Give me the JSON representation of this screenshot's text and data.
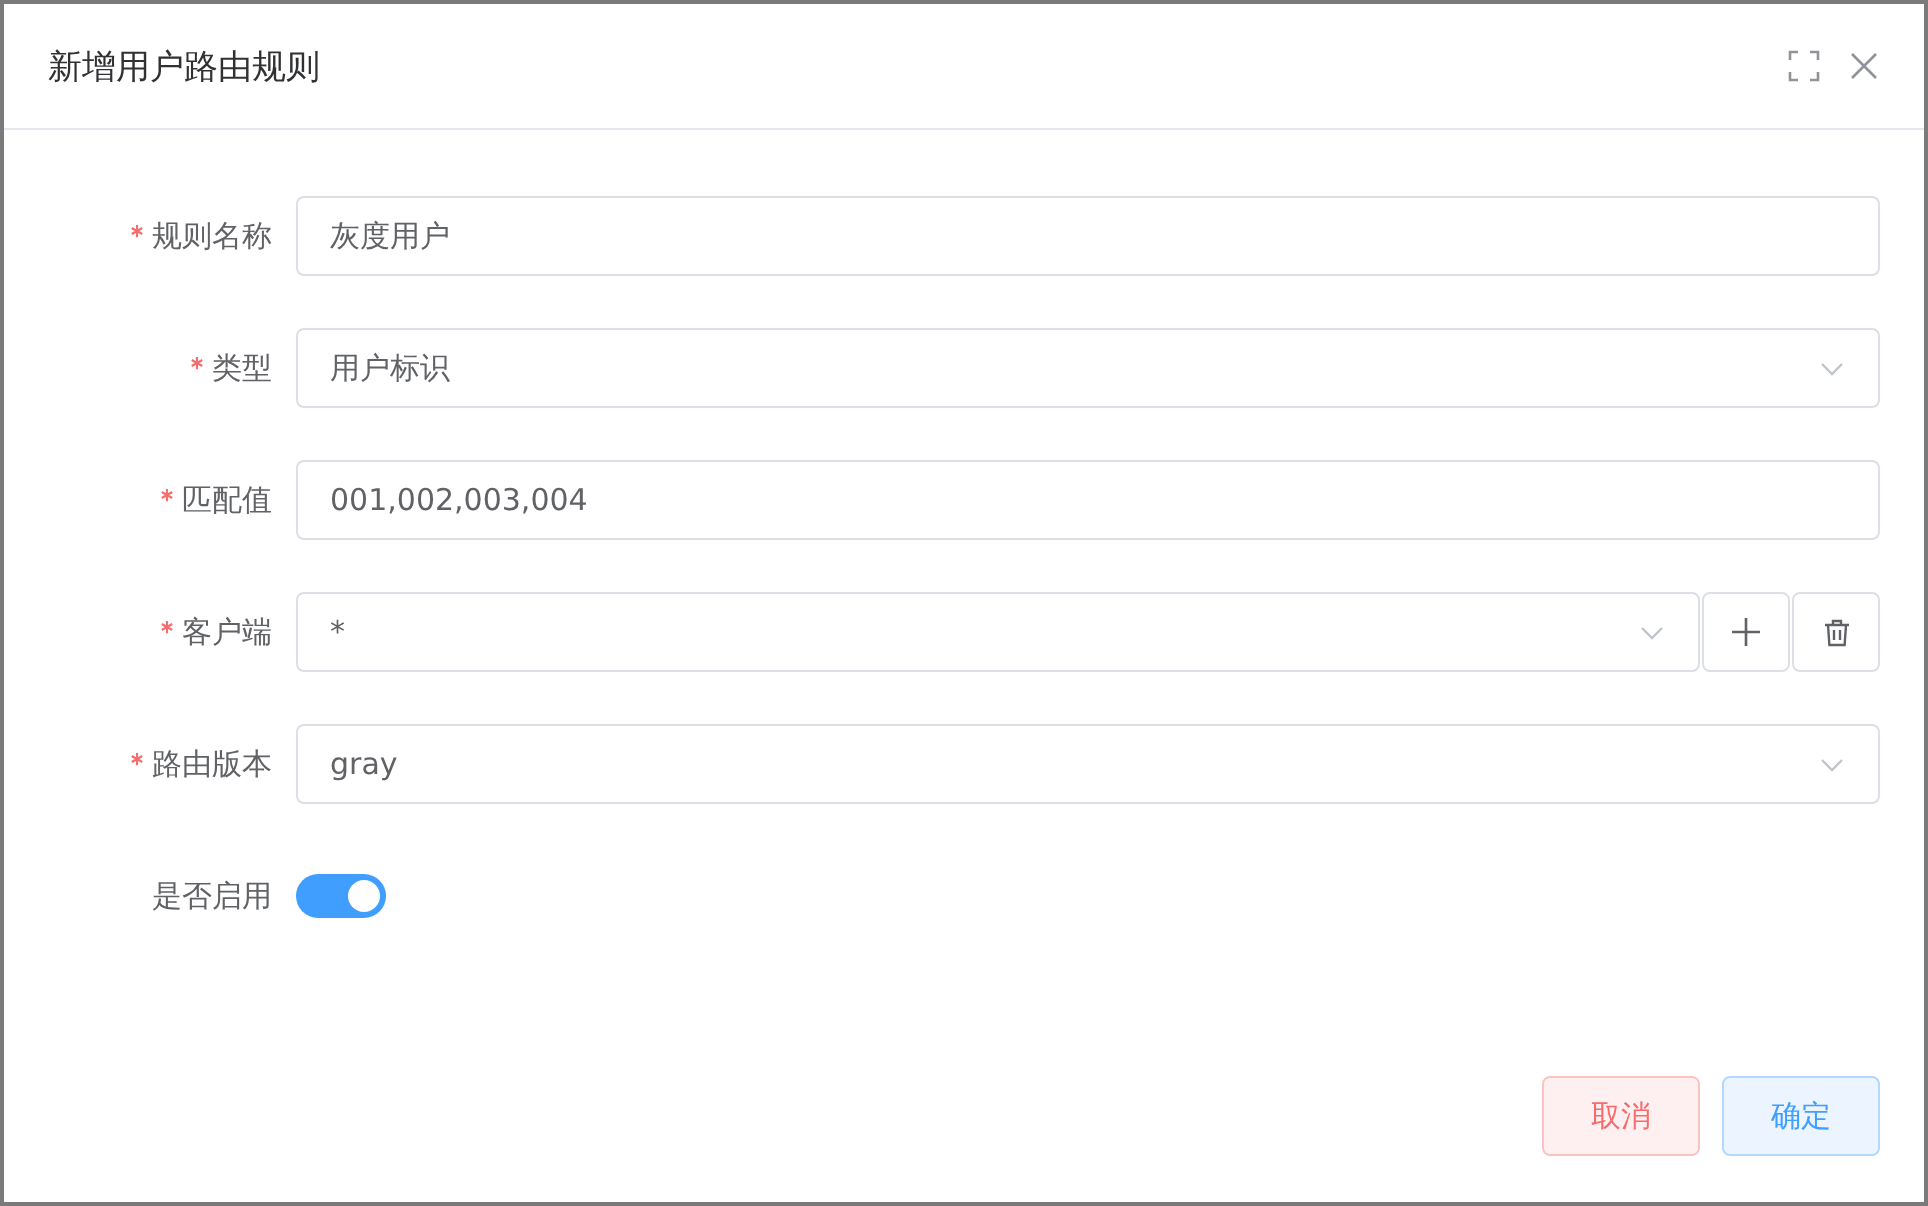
{
  "dialog": {
    "title": "新增用户路由规则"
  },
  "fields": [
    {
      "kind": "input",
      "label": "规则名称",
      "required": true,
      "value": "灰度用户"
    },
    {
      "kind": "select",
      "label": "类型",
      "required": true,
      "value": "用户标识"
    },
    {
      "kind": "input",
      "label": "匹配值",
      "required": true,
      "value": "001,002,003,004"
    },
    {
      "kind": "select_actions",
      "label": "客户端",
      "required": true,
      "value": "*"
    },
    {
      "kind": "select",
      "label": "路由版本",
      "required": true,
      "value": "gray"
    },
    {
      "kind": "switch",
      "label": "是否启用",
      "required": false,
      "on": true
    }
  ],
  "buttons": [
    {
      "kind": "cancel",
      "label": "取消"
    },
    {
      "kind": "confirm",
      "label": "确定"
    }
  ]
}
